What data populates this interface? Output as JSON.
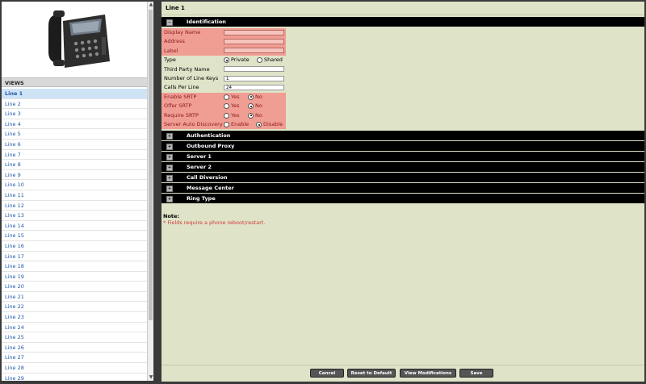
{
  "sidebar": {
    "views_header": "VIEWS",
    "items": [
      "Line 1",
      "Line 2",
      "Line 3",
      "Line 4",
      "Line 5",
      "Line 6",
      "Line 7",
      "Line 8",
      "Line 9",
      "Line 10",
      "Line 11",
      "Line 12",
      "Line 13",
      "Line 14",
      "Line 15",
      "Line 16",
      "Line 17",
      "Line 18",
      "Line 19",
      "Line 20",
      "Line 21",
      "Line 22",
      "Line 23",
      "Line 24",
      "Line 25",
      "Line 26",
      "Line 27",
      "Line 28",
      "Line 29"
    ],
    "selected": "Line 1"
  },
  "main": {
    "title": "Line 1",
    "sections": {
      "identification": "Identification",
      "authentication": "Authentication",
      "outbound_proxy": "Outbound Proxy",
      "server1": "Server 1",
      "server2": "Server 2",
      "call_diversion": "Call Diversion",
      "message_center": "Message Center",
      "ring_type": "Ring Type"
    },
    "fields": {
      "display_name": {
        "label": "Display Name",
        "value": ""
      },
      "address": {
        "label": "Address",
        "value": ""
      },
      "label": {
        "label": "Label",
        "value": ""
      },
      "type": {
        "label": "Type",
        "options": [
          "Private",
          "Shared"
        ],
        "selected": "Private"
      },
      "third_party_name": {
        "label": "Third Party Name",
        "value": ""
      },
      "num_line_keys": {
        "label": "Number of Line Keys",
        "value": "1"
      },
      "calls_per_line": {
        "label": "Calls Per Line",
        "value": "24"
      },
      "enable_srtp": {
        "label": "Enable SRTP",
        "options": [
          "Yes",
          "No"
        ],
        "selected": "No"
      },
      "offer_srtp": {
        "label": "Offer SRTP",
        "options": [
          "Yes",
          "No"
        ],
        "selected": "No"
      },
      "require_srtp": {
        "label": "Require SRTP",
        "options": [
          "Yes",
          "No"
        ],
        "selected": "No"
      },
      "server_auto_discovery": {
        "label": "Server Auto Discovery",
        "options": [
          "Enable",
          "Disable"
        ],
        "selected": "Disable"
      }
    },
    "note": {
      "title": "Note:",
      "text": "* Fields require a phone reboot/restart."
    }
  },
  "footer": {
    "cancel": "Cancel",
    "reset": "Reset to Default",
    "view_mods": "View Modifications",
    "save": "Save"
  },
  "icons": {
    "expand": "expand-icon",
    "phone": "desk-phone-image"
  },
  "colors": {
    "section_bar": "#000000",
    "highlight": "#f09d94",
    "background": "#dfe3c8"
  }
}
